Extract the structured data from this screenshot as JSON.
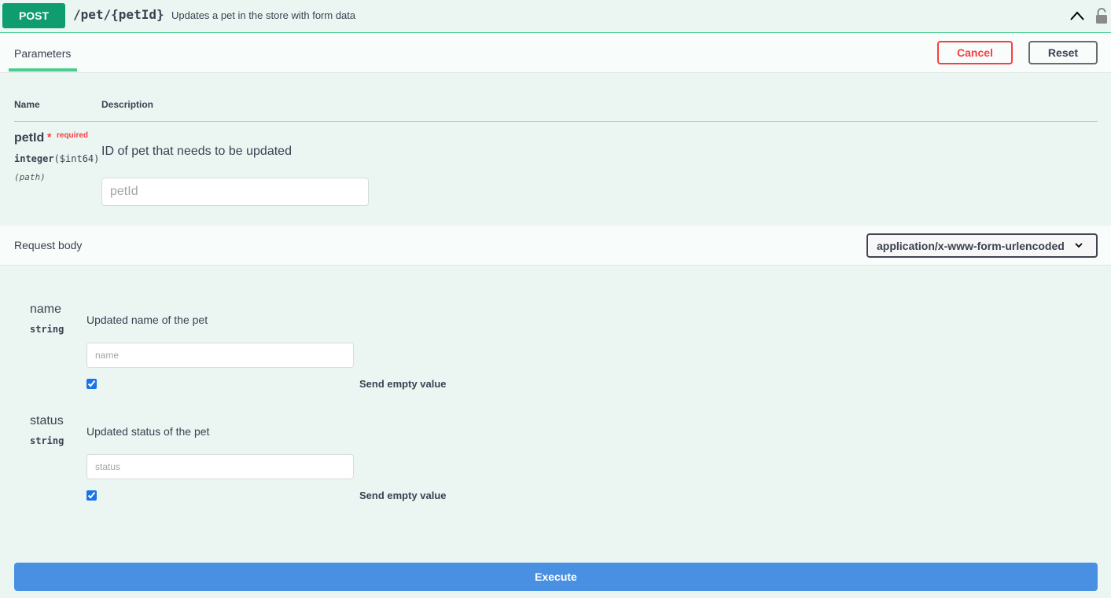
{
  "operation": {
    "method": "POST",
    "path": "/pet/{petId}",
    "summary": "Updates a pet in the store with form data",
    "icons": [
      "chevron-up-icon",
      "lock-icon"
    ]
  },
  "tabs": {
    "parameters_label": "Parameters",
    "cancel_label": "Cancel",
    "reset_label": "Reset"
  },
  "params_table": {
    "col_name": "Name",
    "col_description": "Description",
    "param": {
      "name": "petId",
      "required_star": "*",
      "required_label": "required",
      "type": "integer",
      "format": "($int64)",
      "location": "(path)",
      "description": "ID of pet that needs to be updated",
      "placeholder": "petId",
      "value": ""
    }
  },
  "request_body": {
    "label": "Request body",
    "content_type": "application/x-www-form-urlencoded",
    "fields": [
      {
        "name": "name",
        "type": "string",
        "description": "Updated name of the pet",
        "placeholder": "name",
        "value": "",
        "send_empty_checked": true,
        "send_empty_label": "Send empty value"
      },
      {
        "name": "status",
        "type": "string",
        "description": "Updated status of the pet",
        "placeholder": "status",
        "value": "",
        "send_empty_checked": true,
        "send_empty_label": "Send empty value"
      }
    ]
  },
  "execute_label": "Execute",
  "colors": {
    "accent": "#49cc90",
    "method_bg": "#0f9d70",
    "cancel": "#f93e3e",
    "execute": "#4990e2",
    "background": "#ebf6f2"
  }
}
